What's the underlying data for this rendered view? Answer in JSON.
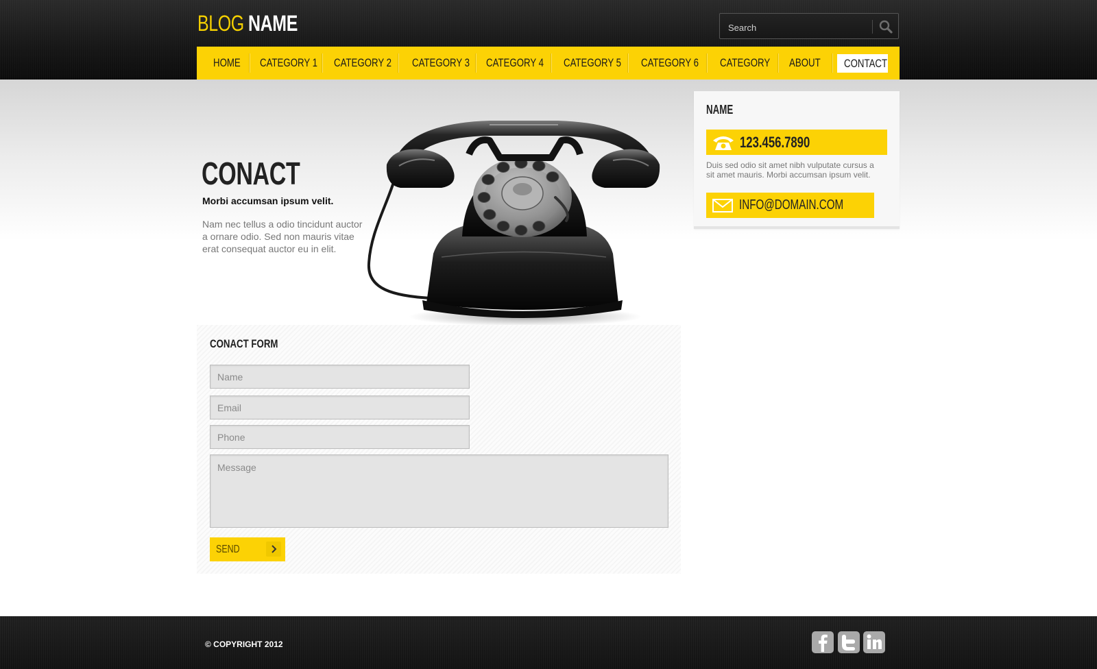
{
  "header": {
    "logo_blog": "BLOG",
    "logo_name": "NAME",
    "search_placeholder": "Search"
  },
  "nav": {
    "items": [
      {
        "label": "HOME"
      },
      {
        "label": "CATEGORY 1"
      },
      {
        "label": "CATEGORY 2"
      },
      {
        "label": "CATEGORY 3"
      },
      {
        "label": "CATEGORY 4"
      },
      {
        "label": "CATEGORY 5"
      },
      {
        "label": "CATEGORY 6"
      },
      {
        "label": "CATEGORY"
      },
      {
        "label": "ABOUT"
      },
      {
        "label": "CONTACT",
        "active": true
      }
    ]
  },
  "hero": {
    "title": "CONACT",
    "subtitle": "Morbi accumsan ipsum velit.",
    "text": "Nam nec tellus a odio tincidunt auctor a ornare odio. Sed non  mauris vitae erat consequat auctor eu in elit.",
    "image_icon": "rotary-telephone-icon"
  },
  "form": {
    "title": "CONACT FORM",
    "name_placeholder": "Name",
    "email_placeholder": "Email",
    "phone_placeholder": "Phone",
    "message_placeholder": "Message",
    "send_label": "SEND",
    "send_icon": "chevron-right-icon"
  },
  "sidebar": {
    "name": "NAME",
    "phone": "123.456.7890",
    "phone_icon": "telephone-icon",
    "description": "Duis sed odio sit amet nibh vulputate cursus a sit amet mauris. Morbi accumsan ipsum velit.",
    "email": "INFO@DOMAIN.COM",
    "email_icon": "envelope-icon"
  },
  "footer": {
    "copyright": "© COPYRIGHT 2012",
    "social": [
      "facebook-icon",
      "twitter-icon",
      "linkedin-icon"
    ]
  },
  "colors": {
    "accent": "#fcd205",
    "dark": "#161616",
    "text_muted": "#777777"
  }
}
